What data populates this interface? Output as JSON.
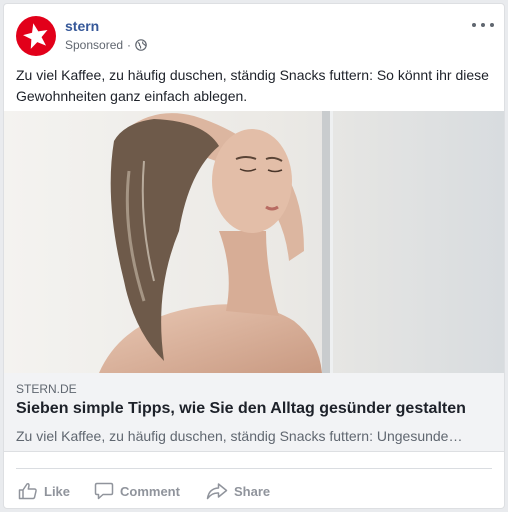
{
  "page": {
    "name": "stern",
    "sponsored_label": "Sponsored",
    "dot_separator": "·"
  },
  "post": {
    "text": "Zu viel Kaffee, zu häufig duschen, ständig Snacks futtern: So könnt ihr diese Gewohnheiten ganz einfach ablegen."
  },
  "link_preview": {
    "domain": "STERN.DE",
    "headline": "Sieben simple Tipps, wie Sie den Alltag gesünder gestalten",
    "description": "Zu viel Kaffee, zu häufig duschen, ständig Snacks futtern: Ungesunde…"
  },
  "actions": {
    "like_label": "Like",
    "comment_label": "Comment",
    "share_label": "Share"
  },
  "icons": {
    "logo": "stern-star-logo",
    "audience": "globe-icon",
    "menu": "more-options-icon",
    "like": "thumbs-up-icon",
    "comment": "comment-bubble-icon",
    "share": "share-arrow-icon"
  },
  "colors": {
    "brand_red": "#e2001a",
    "link_blue": "#365899",
    "muted_text": "#616770",
    "action_gray": "#90949c"
  }
}
